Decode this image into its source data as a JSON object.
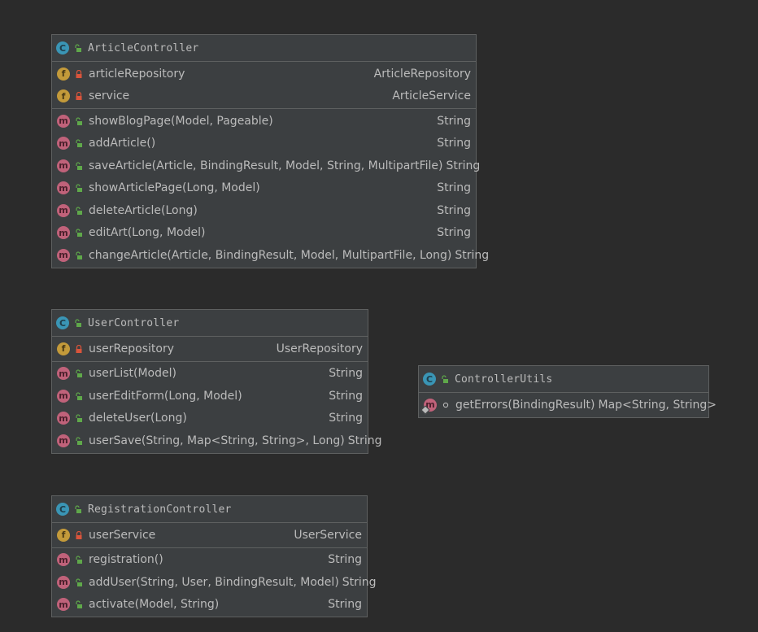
{
  "classes": {
    "article": {
      "name": "ArticleController",
      "fields": [
        {
          "name": "articleRepository",
          "type": "ArticleRepository"
        },
        {
          "name": "service",
          "type": "ArticleService"
        }
      ],
      "methods": [
        {
          "name": "showBlogPage(Model, Pageable)",
          "type": "String"
        },
        {
          "name": "addArticle()",
          "type": "String"
        },
        {
          "name": "saveArticle(Article, BindingResult, Model, String, MultipartFile)",
          "type": "String"
        },
        {
          "name": "showArticlePage(Long, Model)",
          "type": "String"
        },
        {
          "name": "deleteArticle(Long)",
          "type": "String"
        },
        {
          "name": "editArt(Long, Model)",
          "type": "String"
        },
        {
          "name": "changeArticle(Article, BindingResult, Model, MultipartFile, Long)",
          "type": "String"
        }
      ]
    },
    "user": {
      "name": "UserController",
      "fields": [
        {
          "name": "userRepository",
          "type": "UserRepository"
        }
      ],
      "methods": [
        {
          "name": "userList(Model)",
          "type": "String"
        },
        {
          "name": "userEditForm(Long, Model)",
          "type": "String"
        },
        {
          "name": "deleteUser(Long)",
          "type": "String"
        },
        {
          "name": "userSave(String, Map<String, String>, Long)",
          "type": "String"
        }
      ]
    },
    "registration": {
      "name": "RegistrationController",
      "fields": [
        {
          "name": "userService",
          "type": "UserService"
        }
      ],
      "methods": [
        {
          "name": "registration()",
          "type": "String"
        },
        {
          "name": "addUser(String, User, BindingResult, Model)",
          "type": "String"
        },
        {
          "name": "activate(Model, String)",
          "type": "String"
        }
      ]
    },
    "utils": {
      "name": "ControllerUtils",
      "methods": [
        {
          "name": "getErrors(BindingResult)",
          "type": "Map<String, String>"
        }
      ]
    }
  },
  "icons": {
    "class": "C",
    "field": "f",
    "method": "m"
  },
  "colors": {
    "background": "#2b2b2b",
    "box": "#3c3f41",
    "class_badge": "#3a95b5",
    "field_badge": "#c39a3a",
    "method_badge": "#c0627a",
    "public_lock": "#5fa84a",
    "private_lock": "#d9543b"
  }
}
